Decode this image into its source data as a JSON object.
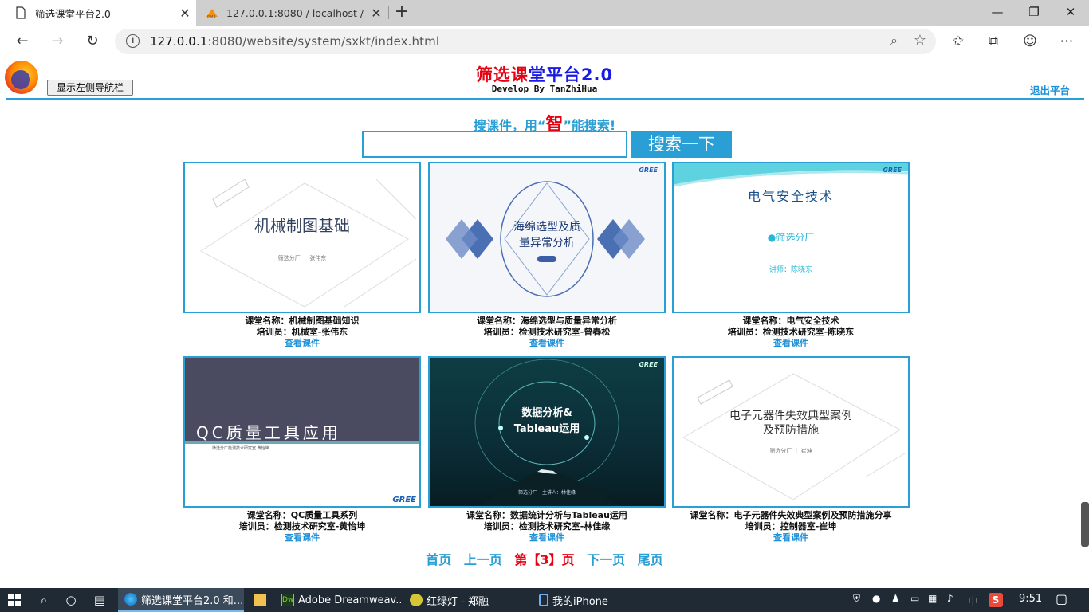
{
  "browser": {
    "tabs": [
      {
        "title": "筛选课堂平台2.0",
        "active": true
      },
      {
        "title": "127.0.0.1:8080 / localhost / sxkt /",
        "active": false
      }
    ],
    "url_host": "127.0.0.1",
    "url_rest": ":8080/website/system/sxkt/index.html",
    "window_controls": {
      "minimize": "—",
      "restore": "❐",
      "close": "✕"
    }
  },
  "header": {
    "toggle_sidebar_label": "显示左侧导航栏",
    "title_part1": "筛选课",
    "title_part2": "堂平台2.0",
    "developer": "Develop By TanZhiHua",
    "logout_label": "退出平台"
  },
  "search": {
    "slogan_pre": "搜课件，用“",
    "slogan_em": "智",
    "slogan_post": "”能搜索!",
    "input_value": "",
    "button_label": "搜索一下"
  },
  "courses": [
    {
      "thumb_title": "机械制图基础",
      "thumb_sub": "筛选分厂 ｜ 张伟东",
      "name": "课堂名称：机械制图基础知识",
      "trainer": "培训员：机械室-张伟东",
      "view": "查看课件"
    },
    {
      "thumb_title": "海绵选型及质量异常分析",
      "thumb_sub": "",
      "name": "课堂名称：海绵选型与质量异常分析",
      "trainer": "培训员：检测技术研究室-曾春松",
      "view": "查看课件"
    },
    {
      "thumb_title": "电气安全技术",
      "thumb_sub": "●筛选分厂",
      "thumb_sub2": "讲师：陈晓东",
      "name": "课堂名称：电气安全技术",
      "trainer": "培训员：检测技术研究室-陈晓东",
      "view": "查看课件"
    },
    {
      "thumb_title": "QC质量工具应用",
      "thumb_sub": "筛选分厂检测技术研究室 黄怡坤",
      "name": "课堂名称：QC质量工具系列",
      "trainer": "培训员：检测技术研究室-黄怡坤",
      "view": "查看课件"
    },
    {
      "thumb_title": "数据分析&",
      "thumb_title2": "Tableau运用",
      "thumb_sub": "筛选分厂　主讲人：林佳缘",
      "name": "课堂名称：数据统计分析与Tableau运用",
      "trainer": "培训员：检测技术研究室-林佳缘",
      "view": "查看课件"
    },
    {
      "thumb_title": "电子元器件失效典型案例",
      "thumb_title2": "及预防措施",
      "thumb_sub": "筛选分厂 ｜ 崔坤",
      "name": "课堂名称：电子元器件失效典型案例及预防措施分享",
      "trainer": "培训员：控制器室-崔坤",
      "view": "查看课件"
    }
  ],
  "gree_logo": "GREE",
  "pagination": {
    "first": "首页",
    "prev": "上一页",
    "current": "第【3】页",
    "next": "下一页",
    "last": "尾页"
  },
  "taskbar": {
    "apps": [
      {
        "label": "筛选课堂平台2.0 和..."
      },
      {
        "label": "Adobe Dreamweav..."
      },
      {
        "label": "红绿灯 - 郑融"
      },
      {
        "label": "我的iPhone"
      }
    ],
    "ime": "中",
    "time": "9:51"
  }
}
